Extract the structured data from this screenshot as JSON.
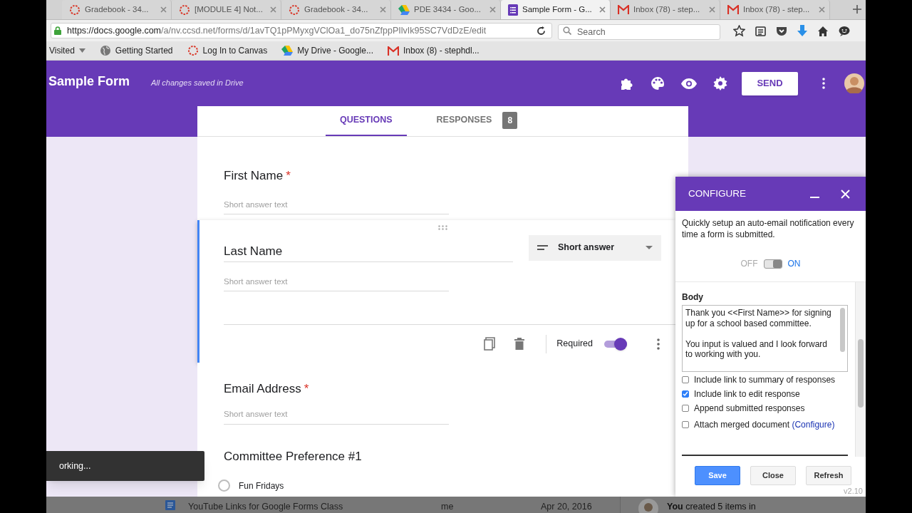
{
  "browser": {
    "tabs": [
      {
        "title": "Gradebook - 34...",
        "selected": false
      },
      {
        "title": "[MODULE 4] Not...",
        "selected": false
      },
      {
        "title": "Gradebook - 34...",
        "selected": false
      },
      {
        "title": "PDE 3434 - Goo...",
        "selected": false
      },
      {
        "title": "Sample Form - G...",
        "selected": true
      },
      {
        "title": "Inbox (78) - step...",
        "selected": false
      },
      {
        "title": "Inbox (78) - step...",
        "selected": false
      }
    ],
    "url_host": "https://docs.google.com",
    "url_path": "/a/nv.ccsd.net/forms/d/1avTQ1pPMyxgVClOa1_do75nZfppPIlvIk95SC7VdDzE/edit",
    "search": {
      "placeholder": "Search"
    },
    "bookmarks": [
      {
        "label": "Visited"
      },
      {
        "label": "Getting Started"
      },
      {
        "label": "Log In to Canvas"
      },
      {
        "label": "My Drive - Google..."
      },
      {
        "label": "Inbox (8) - stephdl..."
      }
    ]
  },
  "form": {
    "title": "Sample Form",
    "save_status": "All changes saved in Drive",
    "send": "SEND",
    "tabs": [
      {
        "label": "QUESTIONS",
        "selected": true
      },
      {
        "label": "RESPONSES",
        "badge": "8",
        "selected": false
      }
    ],
    "questions": [
      {
        "kind": "short",
        "title": "First Name",
        "required_mark": "*",
        "selected": false,
        "placeholder": "Short answer text"
      },
      {
        "kind": "short",
        "title": "Last Name",
        "required": true,
        "selected": true,
        "placeholder": "Short answer text",
        "type_label": "Short answer",
        "required_label": "Required"
      },
      {
        "kind": "short",
        "title": "Email Address",
        "required_mark": "*",
        "selected": false,
        "placeholder": "Short answer text"
      },
      {
        "kind": "choice",
        "title": "Committee Preference #1",
        "selected": false,
        "options": [
          {
            "label": "Fun Fridays"
          }
        ]
      }
    ]
  },
  "toast": "orking...",
  "configure": {
    "title": "CONFIGURE",
    "description": "Quickly setup an auto-email notification every time a form is submitted.",
    "off_label": "OFF",
    "on_label": "ON",
    "on": true,
    "body_label": "Body",
    "body": "Thank you <<First Name>> for signing up for a school based committee.\n\nYou input is valued and I look forward to working with you.",
    "options": [
      {
        "label": "Include link to summary of responses",
        "checked": false
      },
      {
        "label": "Include link to edit response",
        "checked": true
      },
      {
        "label": "Append submitted responses",
        "checked": false
      },
      {
        "label": "Attach merged document",
        "link": "(Configure)",
        "checked": false
      }
    ],
    "buttons": [
      {
        "label": "Save",
        "kind": "primary"
      },
      {
        "label": "Close",
        "kind": "plain"
      },
      {
        "label": "Refresh",
        "kind": "plain"
      }
    ],
    "version": "v2.10"
  },
  "background": {
    "file_name": "YouTube Links for Google Forms Class",
    "owner": "me",
    "date": "Apr 20, 2016",
    "activity": "**You** created 5 items in"
  }
}
